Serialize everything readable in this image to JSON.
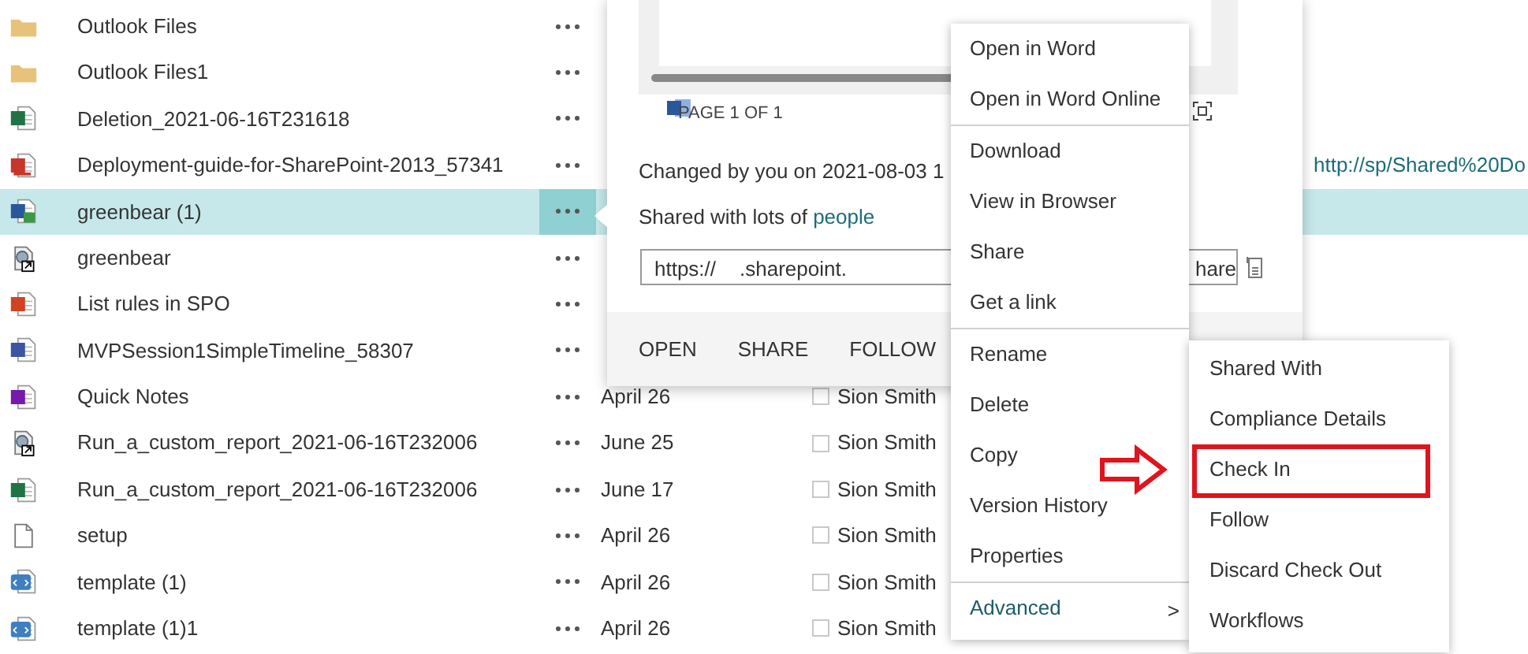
{
  "files": [
    {
      "kind": "folder",
      "name": "Outlook Files",
      "selected": false
    },
    {
      "kind": "folder",
      "name": "Outlook Files1",
      "selected": false
    },
    {
      "kind": "excel",
      "name": "Deletion_2021-06-16T231618",
      "selected": false
    },
    {
      "kind": "pdf",
      "name": "Deployment-guide-for-SharePoint-2013_57341",
      "path": "http://sp/Shared%20Do",
      "selected": false
    },
    {
      "kind": "word",
      "name": "greenbear (1)",
      "selected": true
    },
    {
      "kind": "link",
      "name": "greenbear",
      "selected": false
    },
    {
      "kind": "powerpoint",
      "name": "List rules in SPO",
      "selected": false
    },
    {
      "kind": "visio",
      "name": "MVPSession1SimpleTimeline_58307",
      "selected": false
    },
    {
      "kind": "onenote",
      "name": "Quick Notes",
      "date": "April 26",
      "modified_by": "Sion Smith",
      "selected": false
    },
    {
      "kind": "link",
      "name": "Run_a_custom_report_2021-06-16T232006",
      "date": "June 25",
      "modified_by": "Sion Smith",
      "selected": false
    },
    {
      "kind": "excel",
      "name": "Run_a_custom_report_2021-06-16T232006",
      "date": "June 17",
      "modified_by": "Sion Smith",
      "selected": false
    },
    {
      "kind": "blank",
      "name": "setup",
      "date": "April 26",
      "modified_by": "Sion Smith",
      "selected": false
    },
    {
      "kind": "xml",
      "name": "template (1)",
      "date": "April 26",
      "modified_by": "Sion Smith",
      "selected": false
    },
    {
      "kind": "xml",
      "name": "template (1)1",
      "date": "April 26",
      "modified_by": "Sion Smith",
      "selected": false
    }
  ],
  "callout": {
    "page_label": "PAGE 1 OF 1",
    "changed": "Changed by you on 2021-08-03 1",
    "shared_prefix": "Shared with lots of ",
    "shared_link": "people",
    "url_parts": [
      "https://",
      ".sharepoint.",
      "hare"
    ],
    "actions": [
      "OPEN",
      "SHARE",
      "FOLLOW"
    ]
  },
  "context_menu": {
    "groups": [
      [
        {
          "label": "Open in Word"
        },
        {
          "label": "Open in Word Online"
        }
      ],
      [
        {
          "label": "Download"
        },
        {
          "label": "View in Browser"
        },
        {
          "label": "Share"
        },
        {
          "label": "Get a link"
        }
      ],
      [
        {
          "label": "Rename"
        },
        {
          "label": "Delete"
        },
        {
          "label": "Copy"
        },
        {
          "label": "Version History"
        },
        {
          "label": "Properties"
        }
      ],
      [
        {
          "label": "Advanced",
          "chevron": ">",
          "expanded": true
        }
      ]
    ]
  },
  "submenu": {
    "items": [
      {
        "label": "Shared With",
        "highlighted": false
      },
      {
        "label": "Compliance Details",
        "highlighted": false
      },
      {
        "label": "Check In",
        "highlighted": true
      },
      {
        "label": "Follow",
        "highlighted": false
      },
      {
        "label": "Discard Check Out",
        "highlighted": false
      },
      {
        "label": "Workflows",
        "highlighted": false
      }
    ]
  }
}
